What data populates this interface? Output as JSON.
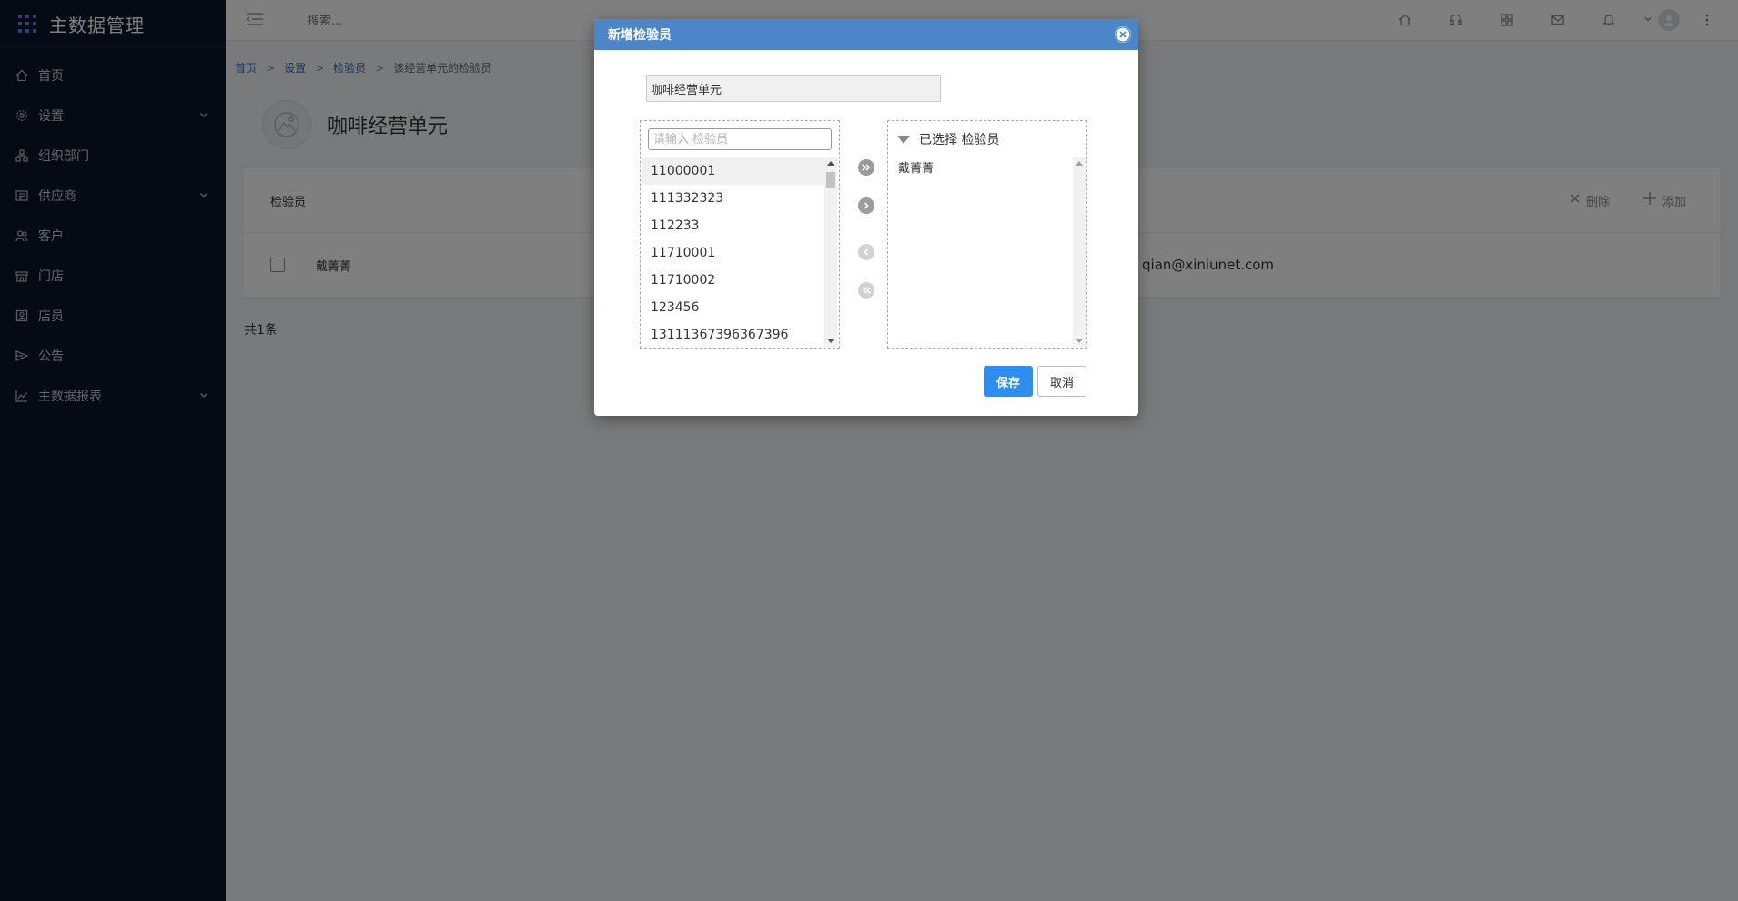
{
  "app": {
    "title": "主数据管理"
  },
  "sidebar": {
    "items": [
      {
        "label": "首页",
        "icon": "home-icon"
      },
      {
        "label": "设置",
        "icon": "gear-icon",
        "expandable": true
      },
      {
        "label": "组织部门",
        "icon": "org-icon"
      },
      {
        "label": "供应商",
        "icon": "supplier-icon",
        "expandable": true
      },
      {
        "label": "客户",
        "icon": "customer-icon"
      },
      {
        "label": "门店",
        "icon": "store-icon"
      },
      {
        "label": "店员",
        "icon": "clerk-icon"
      },
      {
        "label": "公告",
        "icon": "announcement-icon"
      },
      {
        "label": "主数据报表",
        "icon": "chart-icon",
        "expandable": true
      }
    ]
  },
  "header": {
    "search_placeholder": "搜索..."
  },
  "breadcrumb": {
    "home": "首页",
    "sep": ">",
    "settings": "设置",
    "inspector": "检验员",
    "current": "该经营单元的检验员"
  },
  "page": {
    "unit_name": "咖啡经营单元",
    "panel_title": "检验员",
    "delete_label": "删除",
    "add_label": "添加",
    "rows": [
      {
        "name": "戴菁菁",
        "email": "qian@xiniunet.com"
      }
    ],
    "total": "共1条"
  },
  "dialog": {
    "title": "新增检验员",
    "unit_value": "咖啡经营单元",
    "filter_placeholder": "请输入 检验员",
    "available": [
      "11000001",
      "111332323",
      "112233",
      "11710001",
      "11710002",
      "123456",
      "13111367396367396"
    ],
    "selected_header": "已选择 检验员",
    "selected": [
      "戴菁菁"
    ],
    "save_label": "保存",
    "cancel_label": "取消"
  },
  "colors": {
    "sidebar_bg": "#0a1628",
    "dialog_header": "#4b86c8",
    "primary_button": "#2e8df0"
  }
}
